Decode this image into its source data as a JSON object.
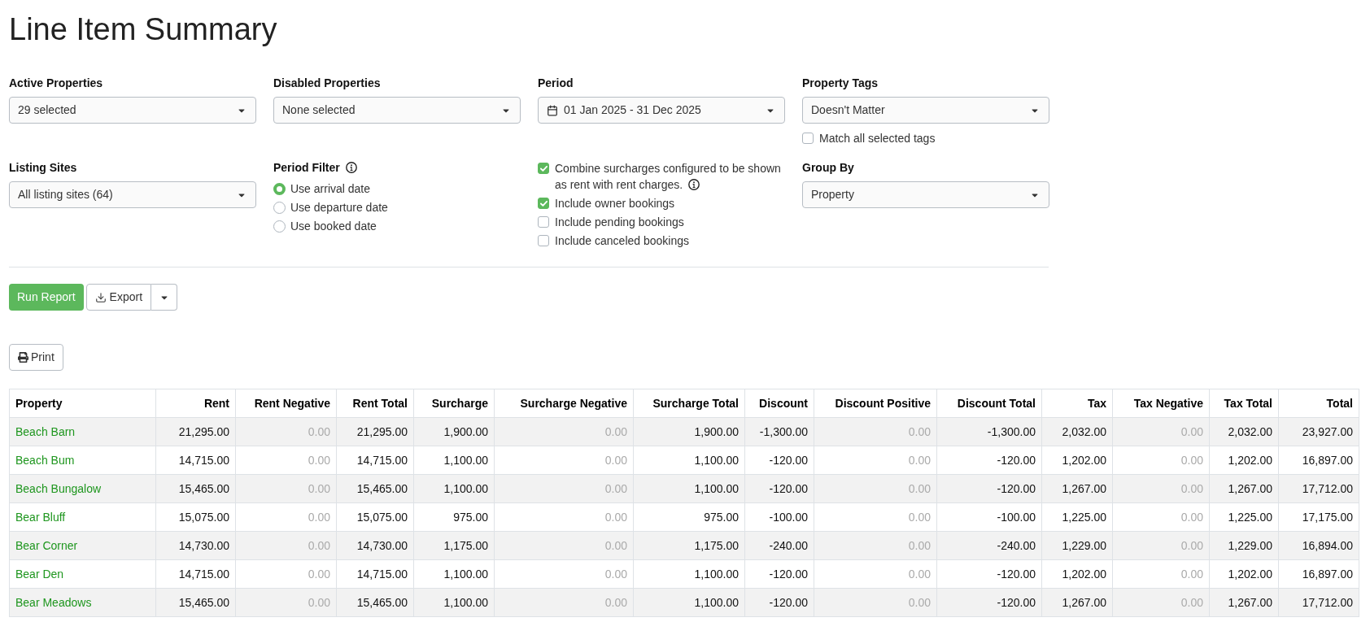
{
  "page_title": "Line Item Summary",
  "filters": [
    {
      "kind": "select",
      "label": "Active Properties",
      "value": "29 selected"
    },
    {
      "kind": "select",
      "label": "Disabled Properties",
      "value": "None selected"
    },
    {
      "kind": "date_range",
      "label": "Period",
      "value": "01 Jan 2025 - 31 Dec 2025"
    },
    {
      "kind": "select",
      "label": "Property Tags",
      "value": "Doesn't Matter",
      "checkbox": {
        "label": "Match all selected tags",
        "checked": false
      }
    },
    {
      "kind": "select",
      "label": "Listing Sites",
      "value": "All listing sites (64)"
    },
    {
      "kind": "radio_group",
      "label": "Period Filter",
      "info": true,
      "options": [
        {
          "label": "Use arrival date",
          "selected": true
        },
        {
          "label": "Use departure date",
          "selected": false
        },
        {
          "label": "Use booked date",
          "selected": false
        }
      ]
    },
    {
      "kind": "checkbox_group",
      "options": [
        {
          "label": "Combine surcharges configured to be shown as rent with rent charges.",
          "checked": true,
          "info": true
        },
        {
          "label": "Include owner bookings",
          "checked": true,
          "info": false
        },
        {
          "label": "Include pending bookings",
          "checked": false,
          "info": false
        },
        {
          "label": "Include canceled bookings",
          "checked": false,
          "info": false
        }
      ]
    },
    {
      "kind": "select",
      "label": "Group By",
      "value": "Property"
    }
  ],
  "actions": [
    {
      "kind": "primary",
      "label": "Run Report"
    },
    {
      "kind": "split",
      "label": "Export"
    }
  ],
  "print_button": {
    "label": "Print"
  },
  "table": {
    "columns": [
      {
        "label": "Property",
        "muted": false
      },
      {
        "label": "Rent",
        "muted": false
      },
      {
        "label": "Rent Negative",
        "muted": true
      },
      {
        "label": "Rent Total",
        "muted": false
      },
      {
        "label": "Surcharge",
        "muted": false
      },
      {
        "label": "Surcharge Negative",
        "muted": true
      },
      {
        "label": "Surcharge Total",
        "muted": false
      },
      {
        "label": "Discount",
        "muted": false
      },
      {
        "label": "Discount Positive",
        "muted": true
      },
      {
        "label": "Discount Total",
        "muted": false
      },
      {
        "label": "Tax",
        "muted": false
      },
      {
        "label": "Tax Negative",
        "muted": true
      },
      {
        "label": "Tax Total",
        "muted": false
      },
      {
        "label": "Total",
        "muted": false
      }
    ],
    "rows": [
      {
        "cells": [
          "Beach Barn",
          "21,295.00",
          "0.00",
          "21,295.00",
          "1,900.00",
          "0.00",
          "1,900.00",
          "-1,300.00",
          "0.00",
          "-1,300.00",
          "2,032.00",
          "0.00",
          "2,032.00",
          "23,927.00"
        ]
      },
      {
        "cells": [
          "Beach Bum",
          "14,715.00",
          "0.00",
          "14,715.00",
          "1,100.00",
          "0.00",
          "1,100.00",
          "-120.00",
          "0.00",
          "-120.00",
          "1,202.00",
          "0.00",
          "1,202.00",
          "16,897.00"
        ]
      },
      {
        "cells": [
          "Beach Bungalow",
          "15,465.00",
          "0.00",
          "15,465.00",
          "1,100.00",
          "0.00",
          "1,100.00",
          "-120.00",
          "0.00",
          "-120.00",
          "1,267.00",
          "0.00",
          "1,267.00",
          "17,712.00"
        ]
      },
      {
        "cells": [
          "Bear Bluff",
          "15,075.00",
          "0.00",
          "15,075.00",
          "975.00",
          "0.00",
          "975.00",
          "-100.00",
          "0.00",
          "-100.00",
          "1,225.00",
          "0.00",
          "1,225.00",
          "17,175.00"
        ]
      },
      {
        "cells": [
          "Bear Corner",
          "14,730.00",
          "0.00",
          "14,730.00",
          "1,175.00",
          "0.00",
          "1,175.00",
          "-240.00",
          "0.00",
          "-240.00",
          "1,229.00",
          "0.00",
          "1,229.00",
          "16,894.00"
        ]
      },
      {
        "cells": [
          "Bear Den",
          "14,715.00",
          "0.00",
          "14,715.00",
          "1,100.00",
          "0.00",
          "1,100.00",
          "-120.00",
          "0.00",
          "-120.00",
          "1,202.00",
          "0.00",
          "1,202.00",
          "16,897.00"
        ]
      },
      {
        "cells": [
          "Bear Meadows",
          "15,465.00",
          "0.00",
          "15,465.00",
          "1,100.00",
          "0.00",
          "1,100.00",
          "-120.00",
          "0.00",
          "-120.00",
          "1,267.00",
          "0.00",
          "1,267.00",
          "17,712.00"
        ]
      }
    ]
  }
}
